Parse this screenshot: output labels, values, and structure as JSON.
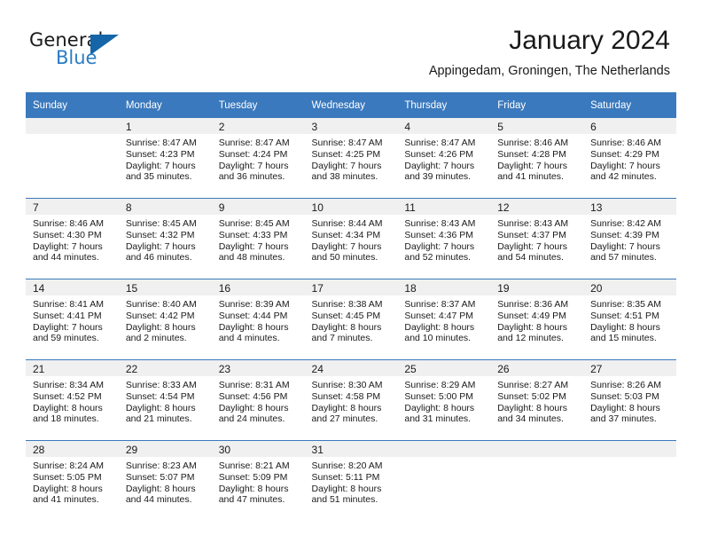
{
  "branding": {
    "name_primary": "General",
    "name_secondary": "Blue",
    "accent_color": "#1565a8",
    "secondary_color": "#2b7cc4"
  },
  "header": {
    "title": "January 2024",
    "location": "Appingedam, Groningen, The Netherlands"
  },
  "theme": {
    "header_band_color": "#3a79bd",
    "daynum_band_color": "#f0f0f0",
    "text_color": "#1a1a1a"
  },
  "weekday_headers": [
    "Sunday",
    "Monday",
    "Tuesday",
    "Wednesday",
    "Thursday",
    "Friday",
    "Saturday"
  ],
  "weeks": [
    [
      {
        "day": "",
        "sunrise": "",
        "sunset": "",
        "daylight_line1": "",
        "daylight_line2": ""
      },
      {
        "day": "1",
        "sunrise": "Sunrise: 8:47 AM",
        "sunset": "Sunset: 4:23 PM",
        "daylight_line1": "Daylight: 7 hours",
        "daylight_line2": "and 35 minutes."
      },
      {
        "day": "2",
        "sunrise": "Sunrise: 8:47 AM",
        "sunset": "Sunset: 4:24 PM",
        "daylight_line1": "Daylight: 7 hours",
        "daylight_line2": "and 36 minutes."
      },
      {
        "day": "3",
        "sunrise": "Sunrise: 8:47 AM",
        "sunset": "Sunset: 4:25 PM",
        "daylight_line1": "Daylight: 7 hours",
        "daylight_line2": "and 38 minutes."
      },
      {
        "day": "4",
        "sunrise": "Sunrise: 8:47 AM",
        "sunset": "Sunset: 4:26 PM",
        "daylight_line1": "Daylight: 7 hours",
        "daylight_line2": "and 39 minutes."
      },
      {
        "day": "5",
        "sunrise": "Sunrise: 8:46 AM",
        "sunset": "Sunset: 4:28 PM",
        "daylight_line1": "Daylight: 7 hours",
        "daylight_line2": "and 41 minutes."
      },
      {
        "day": "6",
        "sunrise": "Sunrise: 8:46 AM",
        "sunset": "Sunset: 4:29 PM",
        "daylight_line1": "Daylight: 7 hours",
        "daylight_line2": "and 42 minutes."
      }
    ],
    [
      {
        "day": "7",
        "sunrise": "Sunrise: 8:46 AM",
        "sunset": "Sunset: 4:30 PM",
        "daylight_line1": "Daylight: 7 hours",
        "daylight_line2": "and 44 minutes."
      },
      {
        "day": "8",
        "sunrise": "Sunrise: 8:45 AM",
        "sunset": "Sunset: 4:32 PM",
        "daylight_line1": "Daylight: 7 hours",
        "daylight_line2": "and 46 minutes."
      },
      {
        "day": "9",
        "sunrise": "Sunrise: 8:45 AM",
        "sunset": "Sunset: 4:33 PM",
        "daylight_line1": "Daylight: 7 hours",
        "daylight_line2": "and 48 minutes."
      },
      {
        "day": "10",
        "sunrise": "Sunrise: 8:44 AM",
        "sunset": "Sunset: 4:34 PM",
        "daylight_line1": "Daylight: 7 hours",
        "daylight_line2": "and 50 minutes."
      },
      {
        "day": "11",
        "sunrise": "Sunrise: 8:43 AM",
        "sunset": "Sunset: 4:36 PM",
        "daylight_line1": "Daylight: 7 hours",
        "daylight_line2": "and 52 minutes."
      },
      {
        "day": "12",
        "sunrise": "Sunrise: 8:43 AM",
        "sunset": "Sunset: 4:37 PM",
        "daylight_line1": "Daylight: 7 hours",
        "daylight_line2": "and 54 minutes."
      },
      {
        "day": "13",
        "sunrise": "Sunrise: 8:42 AM",
        "sunset": "Sunset: 4:39 PM",
        "daylight_line1": "Daylight: 7 hours",
        "daylight_line2": "and 57 minutes."
      }
    ],
    [
      {
        "day": "14",
        "sunrise": "Sunrise: 8:41 AM",
        "sunset": "Sunset: 4:41 PM",
        "daylight_line1": "Daylight: 7 hours",
        "daylight_line2": "and 59 minutes."
      },
      {
        "day": "15",
        "sunrise": "Sunrise: 8:40 AM",
        "sunset": "Sunset: 4:42 PM",
        "daylight_line1": "Daylight: 8 hours",
        "daylight_line2": "and 2 minutes."
      },
      {
        "day": "16",
        "sunrise": "Sunrise: 8:39 AM",
        "sunset": "Sunset: 4:44 PM",
        "daylight_line1": "Daylight: 8 hours",
        "daylight_line2": "and 4 minutes."
      },
      {
        "day": "17",
        "sunrise": "Sunrise: 8:38 AM",
        "sunset": "Sunset: 4:45 PM",
        "daylight_line1": "Daylight: 8 hours",
        "daylight_line2": "and 7 minutes."
      },
      {
        "day": "18",
        "sunrise": "Sunrise: 8:37 AM",
        "sunset": "Sunset: 4:47 PM",
        "daylight_line1": "Daylight: 8 hours",
        "daylight_line2": "and 10 minutes."
      },
      {
        "day": "19",
        "sunrise": "Sunrise: 8:36 AM",
        "sunset": "Sunset: 4:49 PM",
        "daylight_line1": "Daylight: 8 hours",
        "daylight_line2": "and 12 minutes."
      },
      {
        "day": "20",
        "sunrise": "Sunrise: 8:35 AM",
        "sunset": "Sunset: 4:51 PM",
        "daylight_line1": "Daylight: 8 hours",
        "daylight_line2": "and 15 minutes."
      }
    ],
    [
      {
        "day": "21",
        "sunrise": "Sunrise: 8:34 AM",
        "sunset": "Sunset: 4:52 PM",
        "daylight_line1": "Daylight: 8 hours",
        "daylight_line2": "and 18 minutes."
      },
      {
        "day": "22",
        "sunrise": "Sunrise: 8:33 AM",
        "sunset": "Sunset: 4:54 PM",
        "daylight_line1": "Daylight: 8 hours",
        "daylight_line2": "and 21 minutes."
      },
      {
        "day": "23",
        "sunrise": "Sunrise: 8:31 AM",
        "sunset": "Sunset: 4:56 PM",
        "daylight_line1": "Daylight: 8 hours",
        "daylight_line2": "and 24 minutes."
      },
      {
        "day": "24",
        "sunrise": "Sunrise: 8:30 AM",
        "sunset": "Sunset: 4:58 PM",
        "daylight_line1": "Daylight: 8 hours",
        "daylight_line2": "and 27 minutes."
      },
      {
        "day": "25",
        "sunrise": "Sunrise: 8:29 AM",
        "sunset": "Sunset: 5:00 PM",
        "daylight_line1": "Daylight: 8 hours",
        "daylight_line2": "and 31 minutes."
      },
      {
        "day": "26",
        "sunrise": "Sunrise: 8:27 AM",
        "sunset": "Sunset: 5:02 PM",
        "daylight_line1": "Daylight: 8 hours",
        "daylight_line2": "and 34 minutes."
      },
      {
        "day": "27",
        "sunrise": "Sunrise: 8:26 AM",
        "sunset": "Sunset: 5:03 PM",
        "daylight_line1": "Daylight: 8 hours",
        "daylight_line2": "and 37 minutes."
      }
    ],
    [
      {
        "day": "28",
        "sunrise": "Sunrise: 8:24 AM",
        "sunset": "Sunset: 5:05 PM",
        "daylight_line1": "Daylight: 8 hours",
        "daylight_line2": "and 41 minutes."
      },
      {
        "day": "29",
        "sunrise": "Sunrise: 8:23 AM",
        "sunset": "Sunset: 5:07 PM",
        "daylight_line1": "Daylight: 8 hours",
        "daylight_line2": "and 44 minutes."
      },
      {
        "day": "30",
        "sunrise": "Sunrise: 8:21 AM",
        "sunset": "Sunset: 5:09 PM",
        "daylight_line1": "Daylight: 8 hours",
        "daylight_line2": "and 47 minutes."
      },
      {
        "day": "31",
        "sunrise": "Sunrise: 8:20 AM",
        "sunset": "Sunset: 5:11 PM",
        "daylight_line1": "Daylight: 8 hours",
        "daylight_line2": "and 51 minutes."
      },
      {
        "day": "",
        "sunrise": "",
        "sunset": "",
        "daylight_line1": "",
        "daylight_line2": ""
      },
      {
        "day": "",
        "sunrise": "",
        "sunset": "",
        "daylight_line1": "",
        "daylight_line2": ""
      },
      {
        "day": "",
        "sunrise": "",
        "sunset": "",
        "daylight_line1": "",
        "daylight_line2": ""
      }
    ]
  ]
}
